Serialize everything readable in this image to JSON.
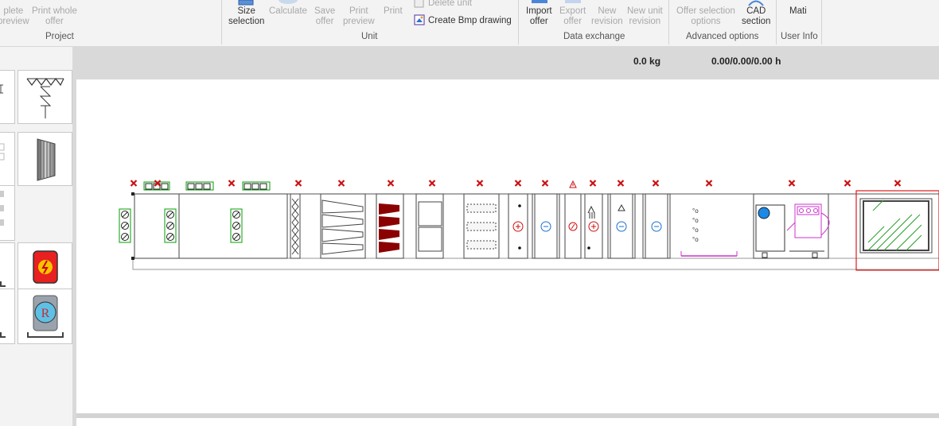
{
  "ribbon": {
    "project": {
      "group_label": "Project",
      "complete_preview": [
        "plete",
        "preview"
      ],
      "print_whole_offer": [
        "Print whole",
        "offer"
      ]
    },
    "unit": {
      "group_label": "Unit",
      "size_selection": [
        "Size",
        "selection"
      ],
      "calculate": "Calculate",
      "save_offer": [
        "Save",
        "offer"
      ],
      "print_preview": [
        "Print",
        "preview"
      ],
      "print": "Print",
      "delete_unit": "Delete unit",
      "create_bmp_drawing": "Create Bmp drawing"
    },
    "data_exchange": {
      "group_label": "Data exchange",
      "import_offer": [
        "Import",
        "offer"
      ],
      "export_offer": [
        "Export",
        "offer"
      ],
      "new_revision": [
        "New",
        "revision"
      ],
      "new_unit_revision": [
        "New unit",
        "revision"
      ]
    },
    "advanced_options": {
      "group_label": "Advanced options",
      "offer_selection_options": [
        "Offer selection",
        "options"
      ],
      "cad_section": [
        "CAD",
        "section"
      ]
    },
    "user_info": {
      "group_label": "User Info",
      "user_name": "Mati"
    }
  },
  "info_bar": {
    "weight": "0.0 kg",
    "hours": "0.00/0.00/0.00 h"
  },
  "colors": {
    "ribbon_bg": "#f3f3f3",
    "info_bar_bg": "#d9d9d9",
    "delete_marker": "#cc1111",
    "damper": "#00a000",
    "coil_icon": "#1a6fd0",
    "heater_icon": "#d01010",
    "silencer_red": "#8b0000",
    "motor": "#cc33cc",
    "selection_frame": "#e01a1a",
    "filter_panel": "#2a9d2a"
  },
  "icons": {
    "left_palette": [
      "damper-section-icon",
      "silencer-section-icon",
      "electric-heater-icon",
      "recuperator-icon"
    ],
    "components": [
      "delete-component-icon",
      "warning-icon",
      "fan-motor-icon",
      "heating-coil-icon",
      "cooling-coil-icon"
    ]
  }
}
